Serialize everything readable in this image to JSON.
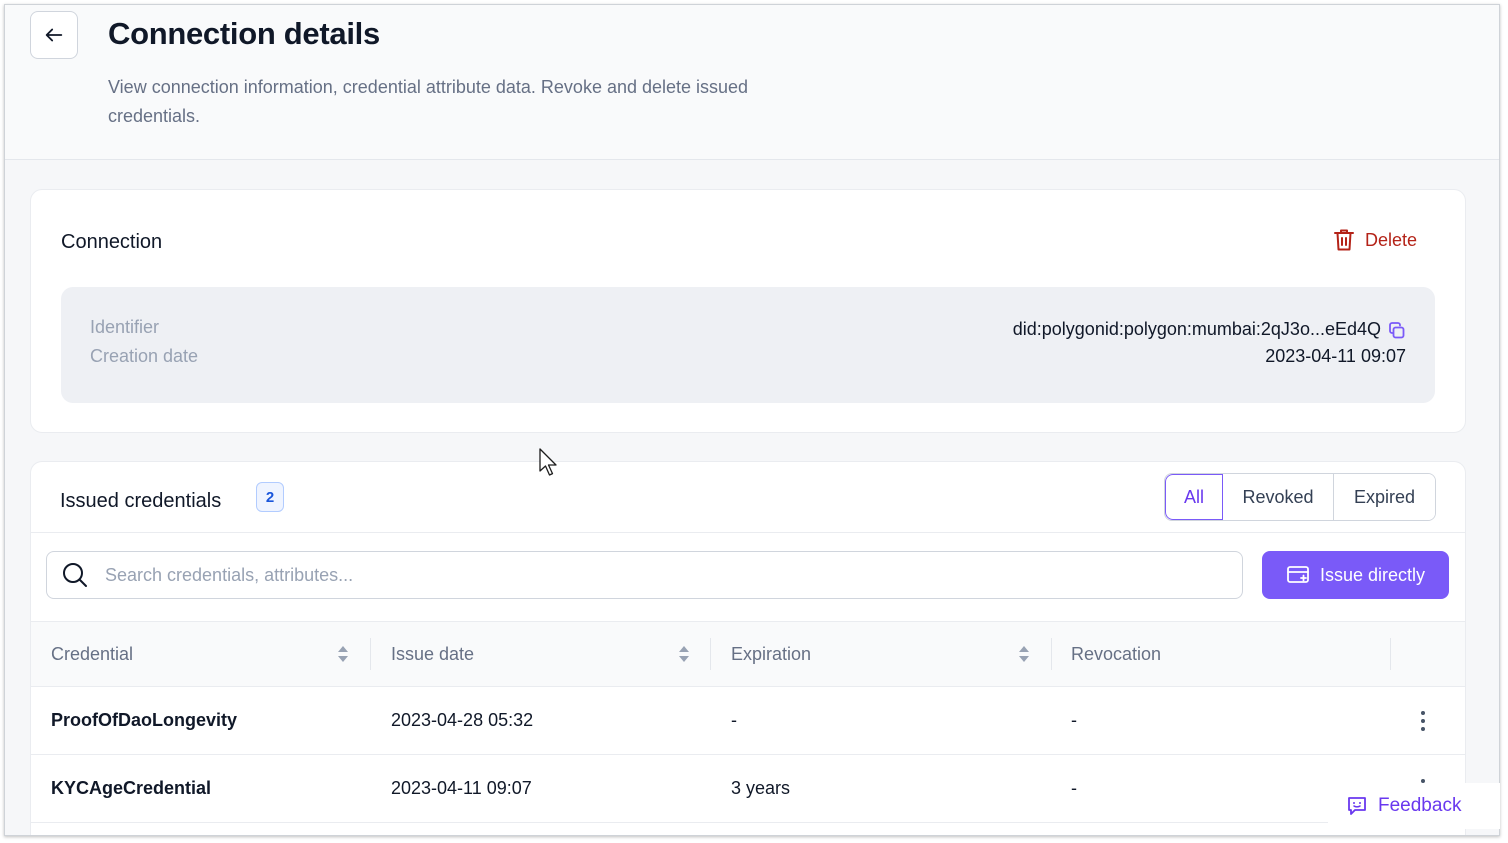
{
  "header": {
    "title": "Connection details",
    "subtitle": "View connection information, credential attribute data. Revoke and delete issued credentials."
  },
  "connection": {
    "title": "Connection",
    "delete_label": "Delete",
    "identifier_label": "Identifier",
    "identifier_value": "did:polygonid:polygon:mumbai:2qJ3o...eEd4Q",
    "creation_label": "Creation date",
    "creation_value": "2023-04-11 09:07"
  },
  "credentials": {
    "title": "Issued credentials",
    "count": "2",
    "filters": [
      {
        "label": "All",
        "active": true
      },
      {
        "label": "Revoked",
        "active": false
      },
      {
        "label": "Expired",
        "active": false
      }
    ],
    "search_placeholder": "Search credentials, attributes...",
    "issue_label": "Issue directly",
    "columns": [
      "Credential",
      "Issue date",
      "Expiration",
      "Revocation"
    ],
    "rows": [
      {
        "credential": "ProofOfDaoLongevity",
        "issue_date": "2023-04-28 05:32",
        "expiration": "-",
        "revocation": "-"
      },
      {
        "credential": "KYCAgeCredential",
        "issue_date": "2023-04-11 09:07",
        "expiration": "3 years",
        "revocation": "-"
      }
    ]
  },
  "feedback": {
    "label": "Feedback"
  },
  "colors": {
    "accent": "#7a5af8",
    "danger": "#b42318",
    "badge": "#1a56db"
  }
}
